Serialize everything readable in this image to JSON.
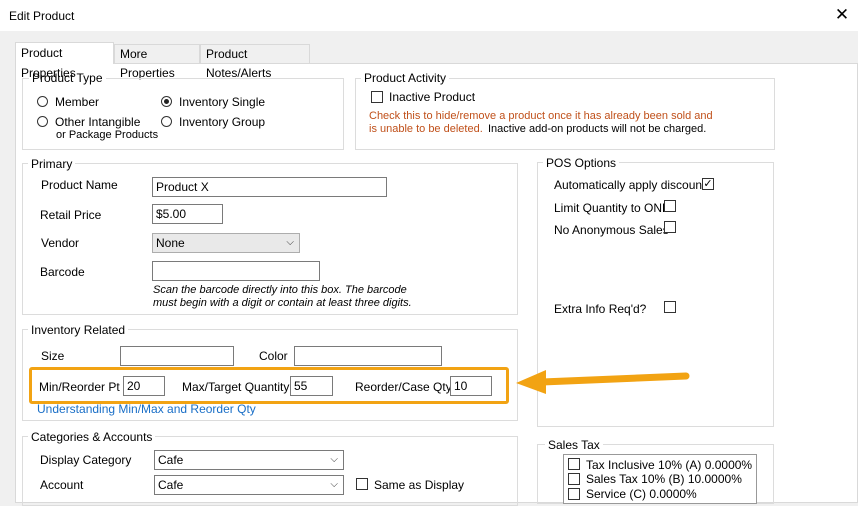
{
  "window": {
    "title": "Edit Product",
    "close_glyph": "✕"
  },
  "tabs": [
    {
      "label": "Product Properties"
    },
    {
      "label": "More Properties"
    },
    {
      "label": "Product Notes/Alerts"
    }
  ],
  "product_type": {
    "title": "Product Type",
    "options": [
      {
        "label": "Member",
        "selected": false
      },
      {
        "label": "Inventory Single",
        "selected": true
      },
      {
        "label": "Other Intangible",
        "sublabel": "or Package Products",
        "selected": false
      },
      {
        "label": "Inventory Group",
        "selected": false
      }
    ]
  },
  "product_activity": {
    "title": "Product Activity",
    "inactive_label": "Inactive Product",
    "warn_line1": "Check this to hide/remove a product once it has already been sold and",
    "warn_line2": "is unable to be deleted.",
    "note_line2": "Inactive add-on products will not be charged."
  },
  "primary": {
    "title": "Primary",
    "name_label": "Product Name",
    "name_value": "Product X",
    "price_label": "Retail Price",
    "price_value": "$5.00",
    "vendor_label": "Vendor",
    "vendor_value": "None",
    "barcode_label": "Barcode",
    "barcode_value": "",
    "barcode_note1": "Scan the barcode directly into this box.  The barcode",
    "barcode_note2": "must begin with a digit or contain at least three digits."
  },
  "pos_options": {
    "title": "POS Options",
    "items": [
      {
        "label": "Automatically apply discounts",
        "checked": true
      },
      {
        "label": "Limit Quantity to ONE",
        "checked": false
      },
      {
        "label": "No Anonymous Sales",
        "checked": false
      },
      {
        "label": "Extra Info Req'd?",
        "checked": false
      }
    ]
  },
  "inventory": {
    "title": "Inventory Related",
    "size_label": "Size",
    "size_value": "",
    "color_label": "Color",
    "color_value": "",
    "min_label": "Min/Reorder Pt",
    "min_value": "20",
    "max_label": "Max/Target Quantity",
    "max_value": "55",
    "case_label": "Reorder/Case Qty",
    "case_value": "10",
    "help_link": "Understanding Min/Max and Reorder Qty"
  },
  "categories": {
    "title": "Categories & Accounts",
    "display_label": "Display Category",
    "display_value": "Cafe",
    "account_label": "Account",
    "account_value": "Cafe",
    "same_label": "Same as Display"
  },
  "sales_tax": {
    "title": "Sales Tax",
    "items": [
      {
        "label": "Tax Inclusive 10% (A) 0.0000%",
        "checked": false
      },
      {
        "label": "Sales Tax 10% (B) 10.0000%",
        "checked": false
      },
      {
        "label": "Service (C) 0.0000%",
        "checked": false
      }
    ]
  },
  "colors": {
    "highlight": "#f2a313",
    "warning_text": "#c0501a",
    "link": "#1a6fc7"
  }
}
